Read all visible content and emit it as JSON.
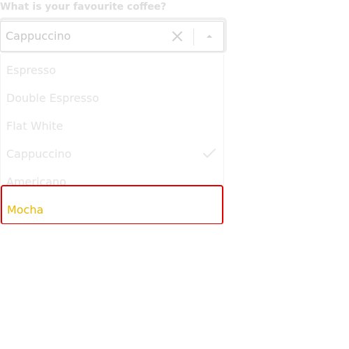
{
  "question": "What is your favourite coffee?",
  "select": {
    "value": "Cappuccino",
    "clear_icon": "close-icon",
    "toggle_icon": "chevron-up-icon"
  },
  "options": [
    {
      "label": "Espresso",
      "selected": false,
      "highlighted": false
    },
    {
      "label": "Double Espresso",
      "selected": false,
      "highlighted": false
    },
    {
      "label": "Flat White",
      "selected": false,
      "highlighted": false
    },
    {
      "label": "Cappuccino",
      "selected": true,
      "highlighted": false
    },
    {
      "label": "Americano",
      "selected": false,
      "highlighted": false
    },
    {
      "label": "Mocha",
      "selected": false,
      "highlighted": true
    }
  ],
  "colors": {
    "highlight_border": "#e00000",
    "highlight_text": "#e8b800",
    "muted_text": "#e3e3e3"
  }
}
